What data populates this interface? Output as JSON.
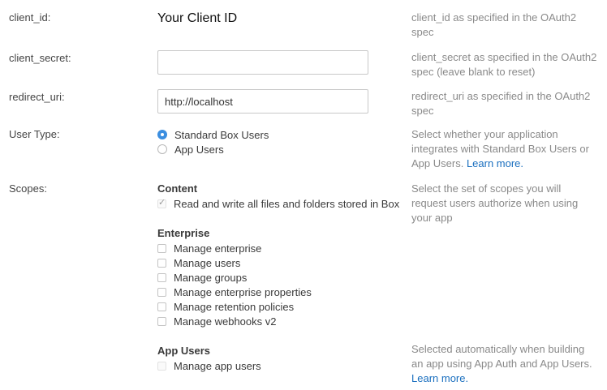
{
  "fields": {
    "client_id": {
      "label": "client_id:",
      "value": "Your Client ID",
      "help": "client_id as specified in the OAuth2 spec"
    },
    "client_secret": {
      "label": "client_secret:",
      "value": "",
      "help": "client_secret as specified in the OAuth2 spec (leave blank to reset)"
    },
    "redirect_uri": {
      "label": "redirect_uri:",
      "value": "http://localhost",
      "help": "redirect_uri as specified in the OAuth2 spec"
    }
  },
  "user_type": {
    "label": "User Type:",
    "options": [
      {
        "label": "Standard Box Users",
        "selected": true
      },
      {
        "label": "App Users",
        "selected": false
      }
    ],
    "help": "Select whether your application integrates with Standard Box Users or App Users.",
    "learn_more": "Learn more."
  },
  "scopes": {
    "label": "Scopes:",
    "help": "Select the set of scopes you will request users authorize when using your app",
    "content": {
      "title": "Content",
      "items": [
        {
          "label": "Read and write all files and folders stored in Box",
          "checked": true
        }
      ]
    },
    "enterprise": {
      "title": "Enterprise",
      "items": [
        {
          "label": "Manage enterprise",
          "checked": false
        },
        {
          "label": "Manage users",
          "checked": false
        },
        {
          "label": "Manage groups",
          "checked": false
        },
        {
          "label": "Manage enterprise properties",
          "checked": false
        },
        {
          "label": "Manage retention policies",
          "checked": false
        },
        {
          "label": "Manage webhooks v2",
          "checked": false
        }
      ]
    },
    "app_users": {
      "title": "App Users",
      "items": [
        {
          "label": "Manage app users",
          "checked": false
        }
      ],
      "help": "Selected automatically when building an app using App Auth and App Users.",
      "learn_more": "Learn more."
    }
  }
}
